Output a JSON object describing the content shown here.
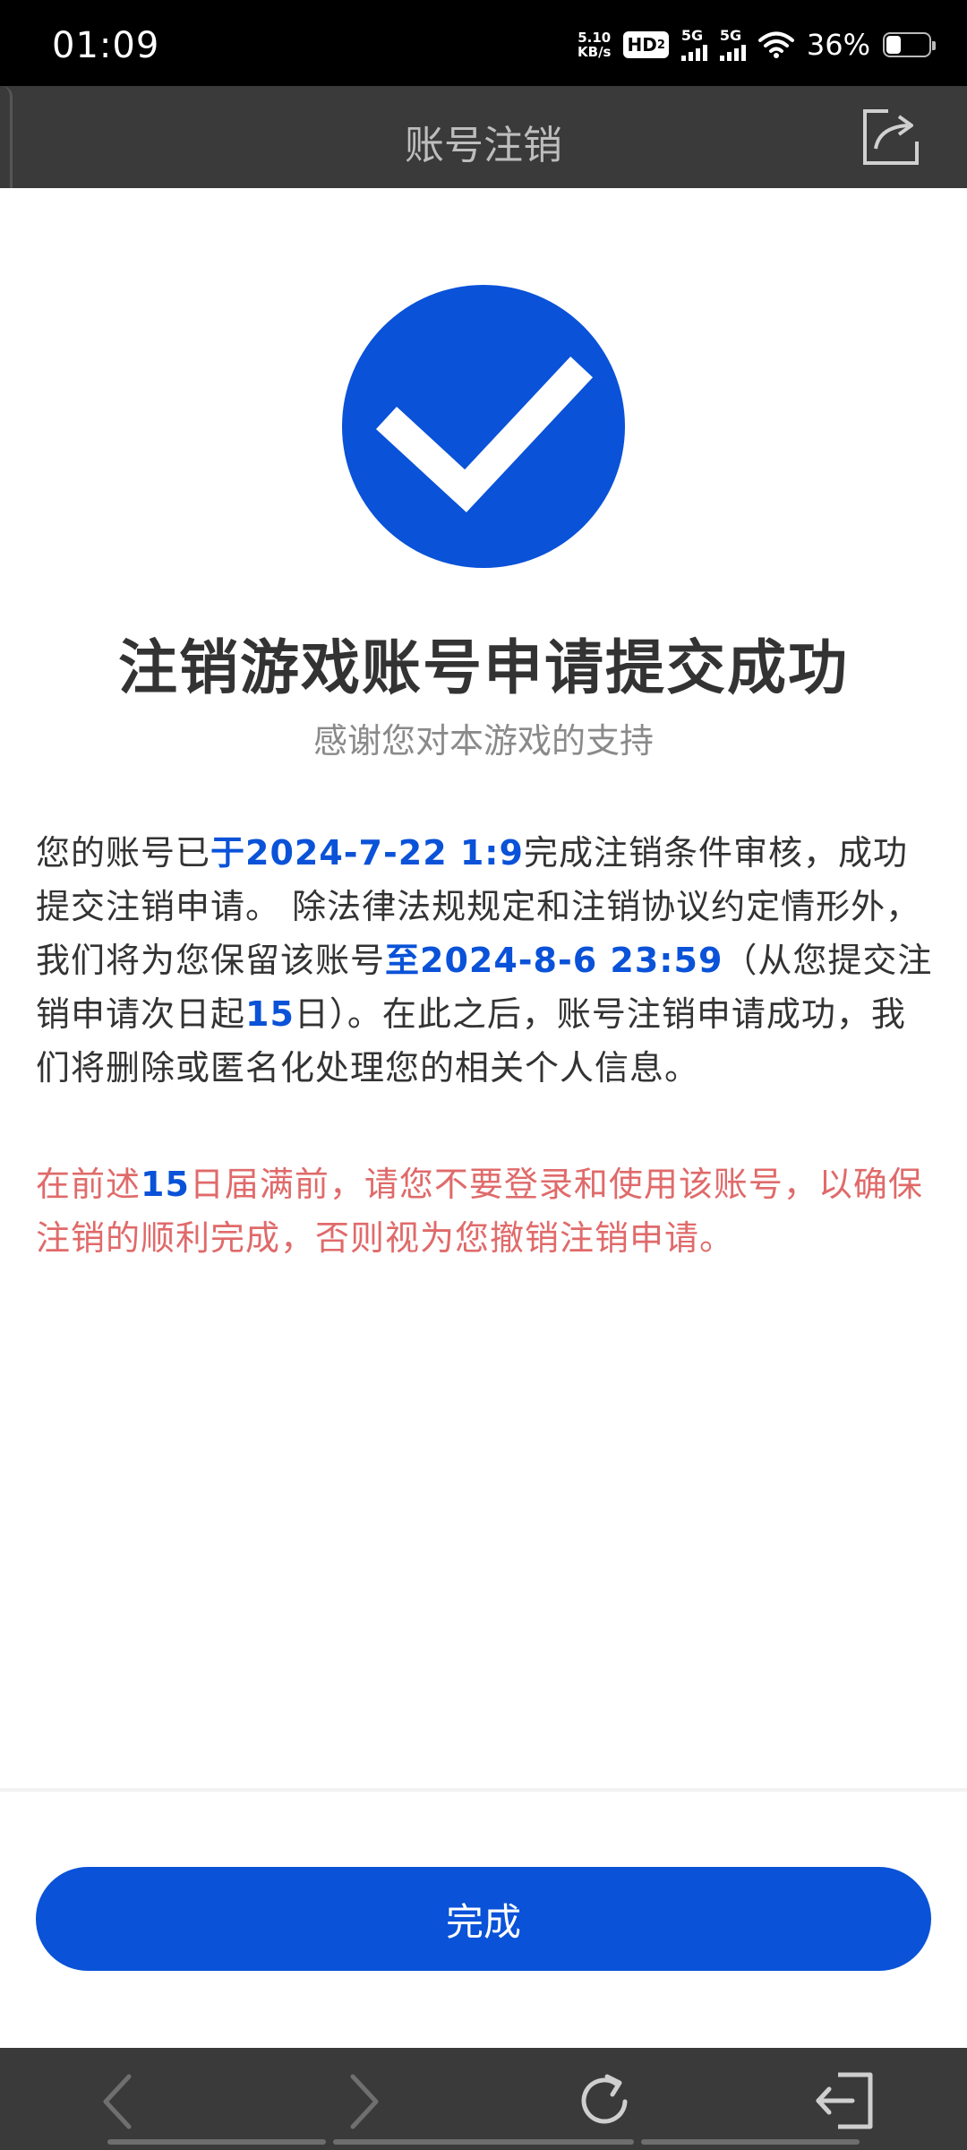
{
  "status_bar": {
    "time": "01:09",
    "net_speed_value": "5.10",
    "net_speed_unit": "KB/s",
    "hd_badge": "HD",
    "hd_sub": "2",
    "signal1_label": "5G",
    "signal2_label": "5G",
    "battery_percent": "36%",
    "battery_level_percent": 36
  },
  "header": {
    "title": "账号注销",
    "share_icon": "share-icon"
  },
  "content": {
    "success_icon": "check-circle-icon",
    "title": "注销游戏账号申请提交成功",
    "subtitle": "感谢您对本游戏的支持",
    "paragraph": {
      "t1": "您的账号已",
      "h1": "于2024-7-22 1:9",
      "t2": "完成注销条件审核，成功提交注销申请。 除法律法规规定和注销协议约定情形外，我们将为您保留该账号",
      "h2": "至2024-8-6 23:59",
      "t3": "（从您提交注销申请次日起",
      "h3": "15",
      "t4": "日）。在此之后，账号注销申请成功，我们将删除或匿名化处理您的相关个人信息。"
    },
    "warning": {
      "t1": "在前述",
      "h1": "15",
      "t2": "日届满前，请您不要登录和使用该账号，以确保注销的顺利完成，否则视为您撤销注销申请。"
    }
  },
  "footer": {
    "done_label": "完成"
  },
  "browser_bar": {
    "back_icon": "chevron-left-icon",
    "forward_icon": "chevron-right-icon",
    "refresh_icon": "refresh-icon",
    "exit_icon": "exit-icon"
  },
  "colors": {
    "accent": "#0a52d8",
    "warning": "#e06a6a",
    "header_bg": "#3a3a3a"
  }
}
